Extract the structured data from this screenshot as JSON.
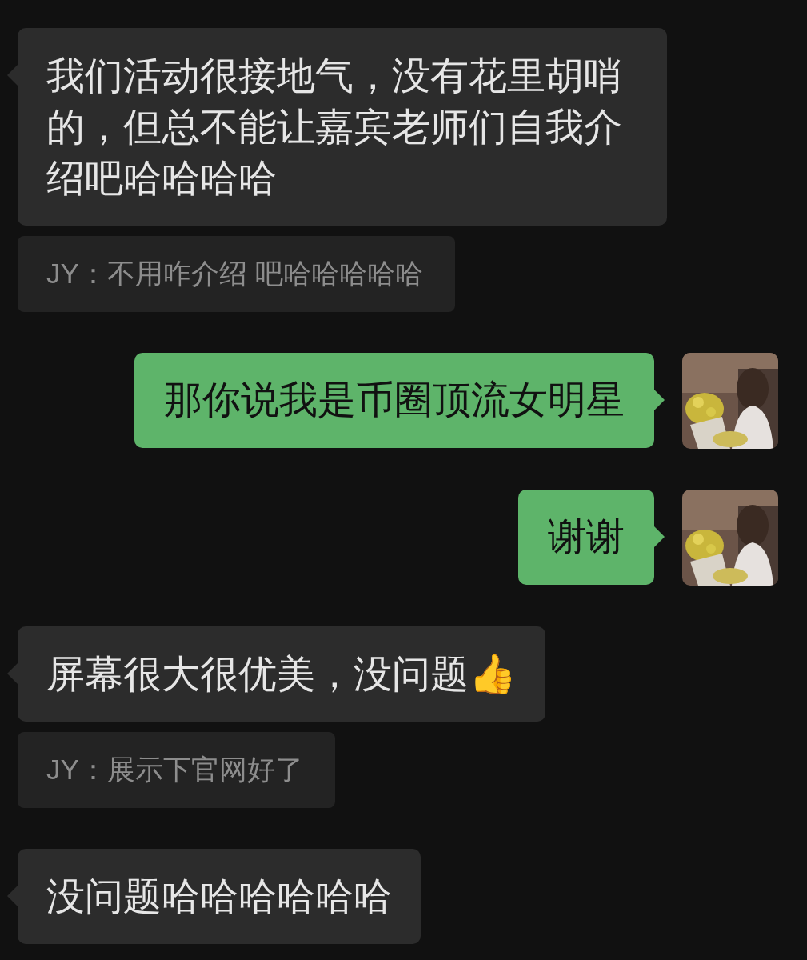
{
  "messages": [
    {
      "kind": "received",
      "text": "我们活动很接地气，没有花里胡哨的，但总不能让嘉宾老师们自我介绍吧哈哈哈哈"
    },
    {
      "kind": "quote",
      "text": "JY：不用咋介绍 吧哈哈哈哈哈"
    },
    {
      "kind": "sent",
      "text": "那你说我是币圈顶流女明星"
    },
    {
      "kind": "sent",
      "text": "谢谢"
    },
    {
      "kind": "received",
      "text": "屏幕很大很优美，没问题👍"
    },
    {
      "kind": "quote",
      "text": "JY：展示下官网好了"
    },
    {
      "kind": "received",
      "text": "没问题哈哈哈哈哈哈"
    }
  ]
}
